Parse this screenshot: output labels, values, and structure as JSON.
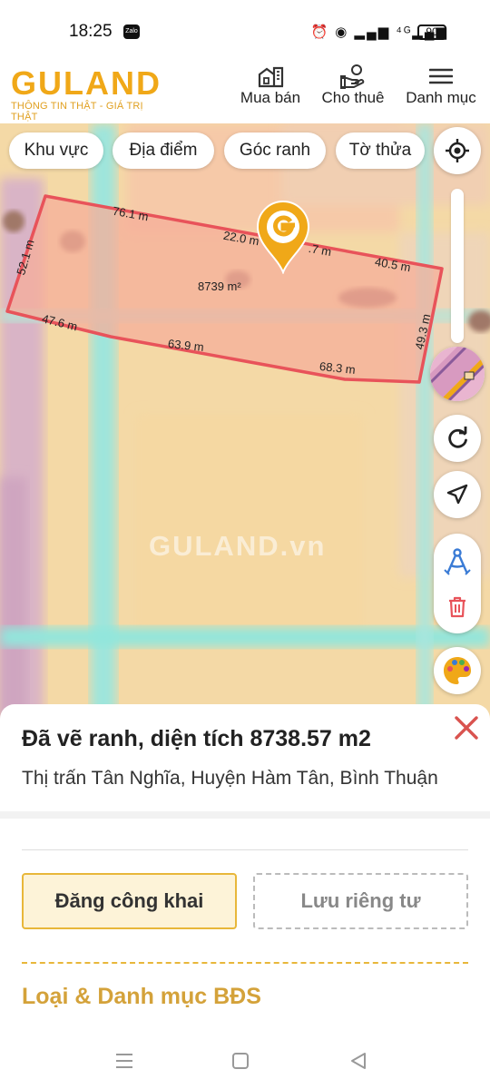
{
  "status_bar": {
    "time": "18:25",
    "zalo": "Zalo",
    "icons": "⏰ ◉ ▂▄▆ ⁴ᴳ▂▄▆",
    "battery": "90"
  },
  "header": {
    "logo_text": "GULAND",
    "tagline": "THÔNG TIN THẬT - GIÁ TRỊ THẬT",
    "nav": {
      "buy": "Mua bán",
      "rent": "Cho thuê",
      "menu": "Danh mục"
    }
  },
  "filters": {
    "area": "Khu vực",
    "place": "Địa điểm",
    "corner": "Góc ranh",
    "parcel": "Tờ thửa"
  },
  "map": {
    "watermark": "GULAND.vn",
    "area_label": "8739 m²",
    "edges": [
      "76.1 m",
      "22.0 m",
      ".7 m",
      "40.5 m",
      "52.1 m",
      "47.6 m",
      "63.9 m",
      "68.3 m",
      "49.3 m"
    ],
    "colors": {
      "parcel_stroke": "#e8535a",
      "parcel_fill": "#f5b0a0",
      "road": "#8fe3d8",
      "residential": "#e8b8c8",
      "marker": "#f0a818"
    }
  },
  "sheet": {
    "title": "Đã vẽ ranh, diện tích 8738.57 m2",
    "address": "Thị trấn Tân Nghĩa, Huyện Hàm Tân, Bình Thuận",
    "publish_button": "Đăng công khai",
    "private_button": "Lưu riêng tư",
    "section_title": "Loại & Danh mục BĐS"
  },
  "accent_color": "#f0a818"
}
